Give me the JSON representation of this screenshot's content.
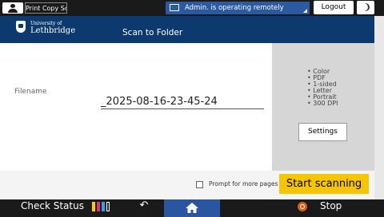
{
  "status_bar": {
    "app_chip": "Print Copy Scan",
    "remote_message": "Admin. is operating remotely",
    "logout_label": "Logout"
  },
  "header": {
    "logo_small": "University of",
    "logo_big": "Lethbridge",
    "title": "Scan to Folder"
  },
  "main": {
    "filename_label": "Filename",
    "filename_value": "_2025-08-16-23-45-24",
    "settings_summary": [
      "Color",
      "PDF",
      "1-sided",
      "Letter",
      "Portrait",
      "300 DPI"
    ],
    "settings_button": "Settings",
    "prompt_label": "Prompt for more pages",
    "prompt_checked": false,
    "start_button": "Start scanning"
  },
  "bottom_bar": {
    "check_status": "Check Status",
    "stop_label": "Stop",
    "toner_colors": [
      "#f5d000",
      "#e0308a",
      "#2aa7e0",
      "#222222"
    ]
  },
  "colors": {
    "header_bg": "#0d3a6e",
    "accent_yellow": "#f6c500",
    "remote_bar": "#2c5aa0"
  }
}
